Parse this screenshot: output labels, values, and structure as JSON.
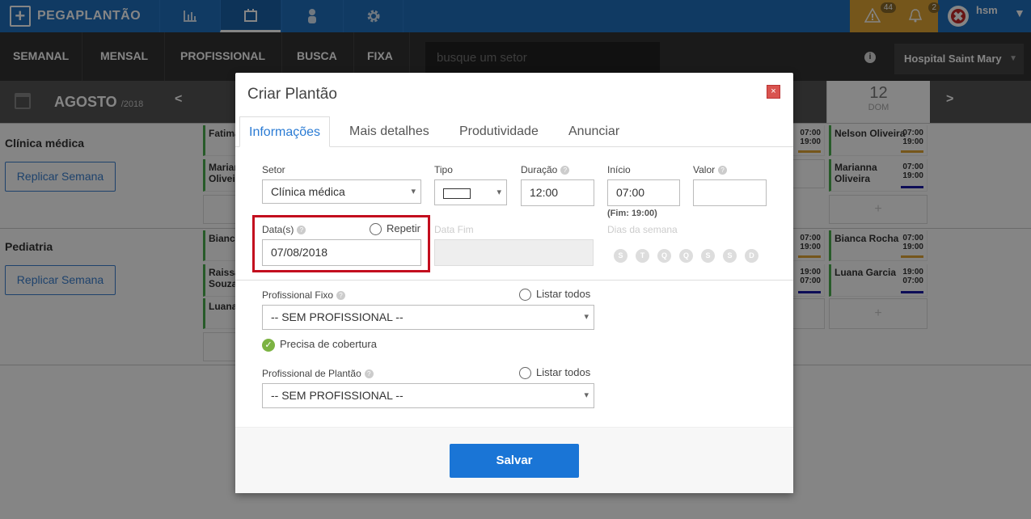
{
  "app": {
    "name": "PEGAPLANTÃO"
  },
  "topbar": {
    "icons": [
      "chart-icon",
      "calendar-icon",
      "person-icon",
      "gear-icon"
    ],
    "alerts": [
      {
        "icon": "warning-icon",
        "count": "44"
      },
      {
        "icon": "bell-icon",
        "count": "2"
      }
    ],
    "user": "hsm"
  },
  "nav": {
    "tabs": [
      "SEMANAL",
      "MENSAL",
      "PROFISSIONAL",
      "BUSCA",
      "FIXA"
    ],
    "active": "SEMANAL",
    "search_placeholder": "busque um setor",
    "info": "i",
    "hospital": "Hospital Saint Mary"
  },
  "calendar": {
    "month": "AGOSTO",
    "year": "/2018",
    "prev": "<",
    "next": ">",
    "day_number": "12",
    "day_name": "DOM"
  },
  "sections": [
    {
      "title": "Clínica médica",
      "replicate": "Replicar Semana",
      "left_shifts": [
        "Fatima",
        "Mariana Oliveira"
      ],
      "right_shifts": [
        {
          "name": "Nelson Oliveira",
          "start": "07:00",
          "end": "19:00",
          "color": "#e0a534"
        },
        {
          "name": "Marianna Oliveira",
          "start": "07:00",
          "end": "19:00",
          "color": "#1a1aa8"
        }
      ],
      "partial_times": [
        {
          "start": "07:00",
          "end": "19:00",
          "color": "#e0a534"
        }
      ]
    },
    {
      "title": "Pediatria",
      "replicate": "Replicar Semana",
      "left_shifts": [
        "Bianca",
        "Raissa Souza",
        "Luana"
      ],
      "right_shifts": [
        {
          "name": "Bianca Rocha",
          "start": "07:00",
          "end": "19:00",
          "color": "#e0a534"
        },
        {
          "name": "Luana Garcia",
          "start": "19:00",
          "end": "07:00",
          "color": "#1a1aa8"
        }
      ],
      "partial_times": [
        {
          "start": "07:00",
          "end": "19:00",
          "color": "#e0a534"
        },
        {
          "start": "19:00",
          "end": "07:00",
          "color": "#1a1aa8"
        }
      ]
    }
  ],
  "modal": {
    "title": "Criar Plantão",
    "close": "×",
    "tabs": [
      "Informações",
      "Mais detalhes",
      "Produtividade",
      "Anunciar"
    ],
    "active_tab": "Informações",
    "setor": {
      "label": "Setor",
      "value": "Clínica médica"
    },
    "tipo": {
      "label": "Tipo"
    },
    "duracao": {
      "label": "Duração",
      "value": "12:00"
    },
    "inicio": {
      "label": "Início",
      "value": "07:00",
      "fim": "(Fim: 19:00)"
    },
    "valor": {
      "label": "Valor",
      "value": ""
    },
    "datas": {
      "label": "Data(s)",
      "value": "07/08/2018",
      "repeat": "Repetir"
    },
    "data_fim": {
      "label": "Data Fim"
    },
    "dias": {
      "label": "Dias da semana",
      "days": [
        "S",
        "T",
        "Q",
        "Q",
        "S",
        "S",
        "D"
      ]
    },
    "profissional_fixo": {
      "label": "Profissional Fixo",
      "list_all": "Listar todos",
      "value": "-- SEM PROFISSIONAL --"
    },
    "cobertura": "Precisa de cobertura",
    "profissional_plantao": {
      "label": "Profissional de Plantão",
      "list_all": "Listar todos",
      "value": "-- SEM PROFISSIONAL --"
    },
    "save": "Salvar"
  },
  "colors": {
    "brand": "#1f6fbf",
    "accent": "#1a75d6",
    "alert": "#e0a534",
    "highlight": "#c30d1e",
    "green": "#4caf50"
  }
}
